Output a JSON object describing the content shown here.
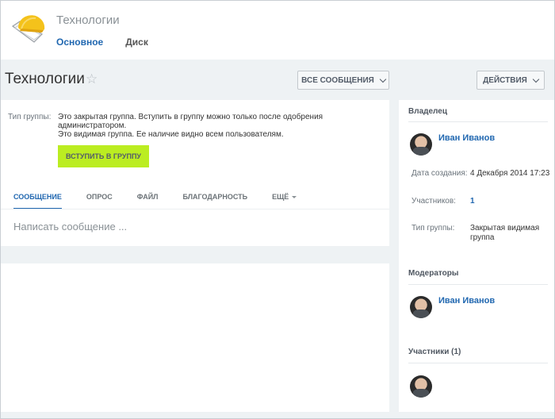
{
  "header": {
    "group_title": "Технологии",
    "tabs": [
      {
        "label": "Основное",
        "active": true
      },
      {
        "label": "Диск",
        "active": false
      }
    ],
    "logo_icon": "folder-with-yellow-helmet-icon"
  },
  "titlebar": {
    "title": "Технологии",
    "favorite_icon": "star-icon",
    "all_messages_label": "ВСЕ СООБЩЕНИЯ",
    "actions_label": "ДЕЙСТВИЯ"
  },
  "group_info": {
    "label": "Тип группы:",
    "line1": "Это закрытая группа. Вступить в группу можно только после одобрения администратором.",
    "line2": "Это видимая группа. Ее наличие видно всем пользователям.",
    "join_label": "ВСТУПИТЬ В ГРУППУ"
  },
  "post_tabs": [
    {
      "label": "СООБЩЕНИЕ",
      "active": true
    },
    {
      "label": "ОПРОС",
      "active": false
    },
    {
      "label": "ФАЙЛ",
      "active": false
    },
    {
      "label": "БЛАГОДАРНОСТЬ",
      "active": false
    },
    {
      "label": "ЕЩЁ",
      "active": false
    }
  ],
  "composer": {
    "placeholder": "Написать сообщение ..."
  },
  "sidebar": {
    "owner_heading": "Владелец",
    "owner_name": "Иван Иванов",
    "created_label": "Дата создания:",
    "created_value": "4 Декабря 2014 17:23",
    "members_label": "Участников:",
    "members_value": "1",
    "type_label": "Тип группы:",
    "type_value": "Закрытая видимая группа",
    "moderators_heading": "Модераторы",
    "moderator_name": "Иван Иванов",
    "participants_heading": "Участники (1)"
  },
  "colors": {
    "accent": "#2067b0",
    "join_button": "#bbed21",
    "page_bg": "#eef2f4"
  }
}
